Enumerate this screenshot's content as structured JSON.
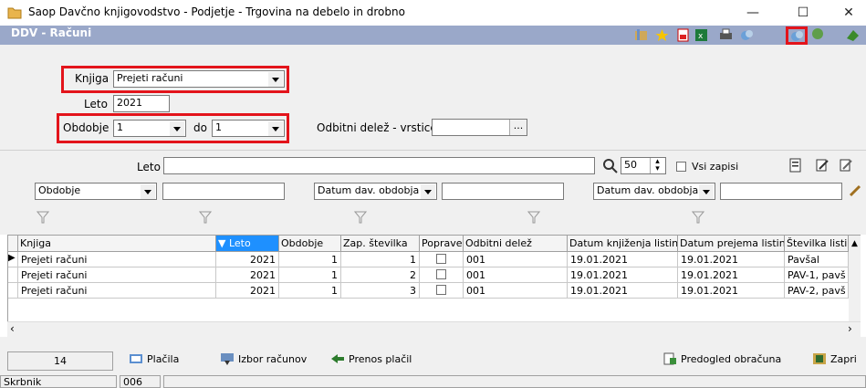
{
  "window": {
    "title": "Saop Davčno knjigovodstvo - Podjetje - Trgovina na debelo in drobno",
    "min": "—",
    "max": "☐",
    "close": "✕"
  },
  "header": {
    "title": "DDV - Računi"
  },
  "form": {
    "knjiga_label": "Knjiga",
    "knjiga_value": "Prejeti računi",
    "leto_label": "Leto",
    "leto_value": "2021",
    "obdobje_label": "Obdobje",
    "obdobje_from": "1",
    "do_label": "do",
    "obdobje_to": "1",
    "odbitni_label": "Odbitni delež - vrstice",
    "odbitni_btn": "..."
  },
  "filter": {
    "leto_label": "Leto",
    "limit_value": "50",
    "vsi_zapisi_label": "Vsi zapisi",
    "combo1": "Obdobje",
    "combo2": "Datum dav. obdobja",
    "combo3": "Datum dav. obdobja"
  },
  "grid": {
    "columns": [
      "Knjiga",
      "▼ Leto",
      "Obdobje",
      "Zap. številka",
      "Popravek",
      "Odbitni delež",
      "Datum knjiženja listine",
      "Datum prejema listine",
      "Številka listine"
    ],
    "rows": [
      [
        "Prejeti računi",
        "2021",
        "1",
        "1",
        "",
        "001",
        "19.01.2021",
        "19.01.2021",
        "Pavšal"
      ],
      [
        "Prejeti računi",
        "2021",
        "1",
        "2",
        "",
        "001",
        "19.01.2021",
        "19.01.2021",
        "PAV-1, pavš"
      ],
      [
        "Prejeti računi",
        "2021",
        "1",
        "3",
        "",
        "001",
        "19.01.2021",
        "19.01.2021",
        "PAV-2, pavš"
      ]
    ]
  },
  "bottom": {
    "count": "14",
    "placila": "Plačila",
    "izbor": "Izbor računov",
    "prenos": "Prenos plačil",
    "predogled": "Predogled obračuna",
    "zapri": "Zapri",
    "status_label": "Skrbnik",
    "status_value": "006"
  }
}
